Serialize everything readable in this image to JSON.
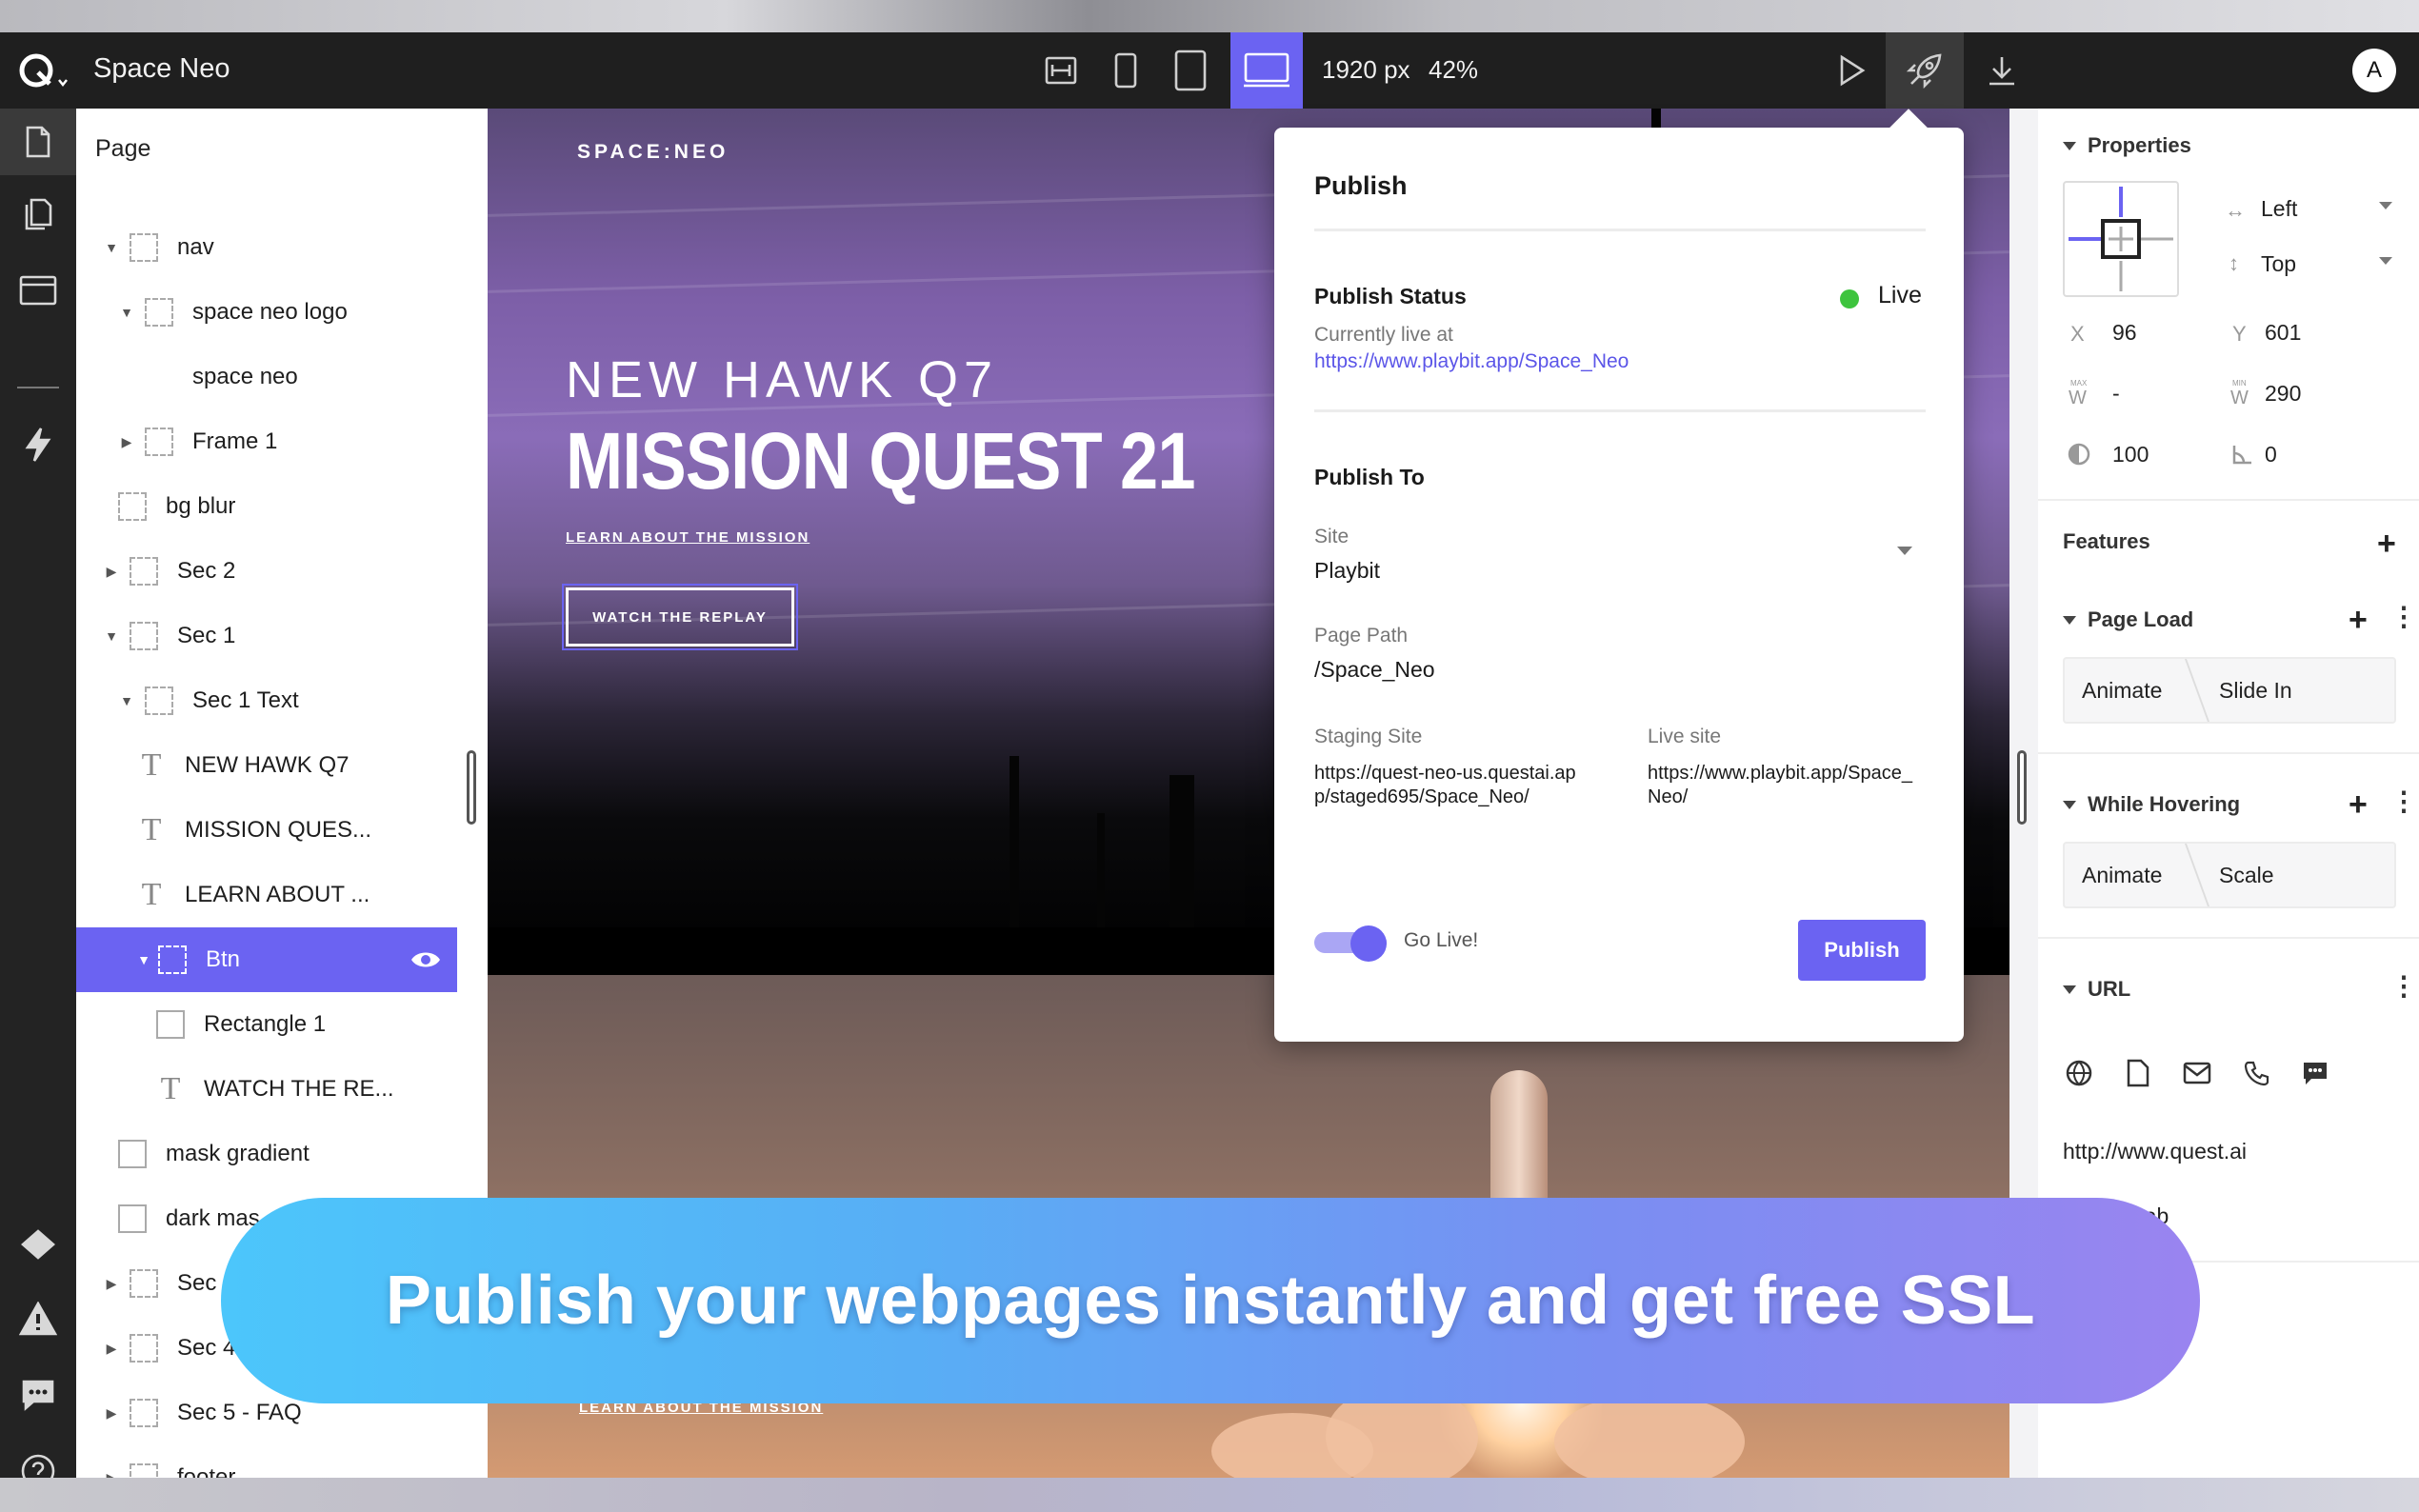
{
  "app": {
    "title": "Space Neo",
    "avatar_initial": "A"
  },
  "toolbar": {
    "viewport_width": "1920 px",
    "zoom": "42%"
  },
  "layers": {
    "heading": "Page",
    "items": [
      {
        "label": "nav"
      },
      {
        "label": "space neo logo"
      },
      {
        "label": "space neo"
      },
      {
        "label": "Frame 1"
      },
      {
        "label": "bg blur"
      },
      {
        "label": "Sec 2"
      },
      {
        "label": "Sec 1"
      },
      {
        "label": "Sec 1 Text"
      },
      {
        "label": "NEW HAWK Q7"
      },
      {
        "label": "MISSION QUES..."
      },
      {
        "label": "LEARN ABOUT ..."
      },
      {
        "label": "Btn"
      },
      {
        "label": "Rectangle 1"
      },
      {
        "label": "WATCH THE RE..."
      },
      {
        "label": "mask gradient"
      },
      {
        "label": "dark mas"
      },
      {
        "label": "Sec"
      },
      {
        "label": "Sec 4"
      },
      {
        "label": "Sec 5 - FAQ"
      },
      {
        "label": "footer"
      }
    ]
  },
  "canvas": {
    "brand": "SPACE:NEO",
    "hero_subtitle": "NEW HAWK Q7",
    "hero_title": "MISSION QUEST 21",
    "hero_link": "LEARN ABOUT THE MISSION",
    "hero_button": "WATCH THE REPLAY",
    "sec2_link": "LEARN ABOUT THE MISSION"
  },
  "publish": {
    "title": "Publish",
    "status_heading": "Publish Status",
    "status_value": "Live",
    "status_color": "#3ec43e",
    "currently_live_label": "Currently live at",
    "currently_live_url": "https://www.playbit.app/Space_Neo",
    "publish_to_heading": "Publish To",
    "site_label": "Site",
    "site_value": "Playbit",
    "path_label": "Page Path",
    "path_value": "/Space_Neo",
    "staging_label": "Staging Site",
    "staging_value": "https://quest-neo-us.questai.app/staged695/Space_Neo/",
    "live_label": "Live site",
    "live_value": "https://www.playbit.app/Space_Neo/",
    "go_live_label": "Go Live!",
    "go_live_on": true,
    "publish_button": "Publish"
  },
  "properties": {
    "heading": "Properties",
    "h_align": "Left",
    "v_align": "Top",
    "x_label": "X",
    "x_value": "96",
    "y_label": "Y",
    "y_value": "601",
    "max_w_value": "-",
    "min_w_value": "290",
    "opacity_value": "100",
    "rotation_value": "0",
    "features_heading": "Features",
    "page_load": {
      "heading": "Page Load",
      "action": "Animate",
      "effect": "Slide In"
    },
    "while_hovering": {
      "heading": "While Hovering",
      "action": "Animate",
      "effect": "Scale"
    },
    "url": {
      "heading": "URL",
      "value": "http://www.quest.ai",
      "new_tab_label": "ch new tab"
    }
  },
  "banner": {
    "text": "Publish your webpages instantly and get free SSL"
  },
  "colors": {
    "accent": "#6b63f2",
    "topbar": "#1f1f1f",
    "rail": "#232323"
  }
}
